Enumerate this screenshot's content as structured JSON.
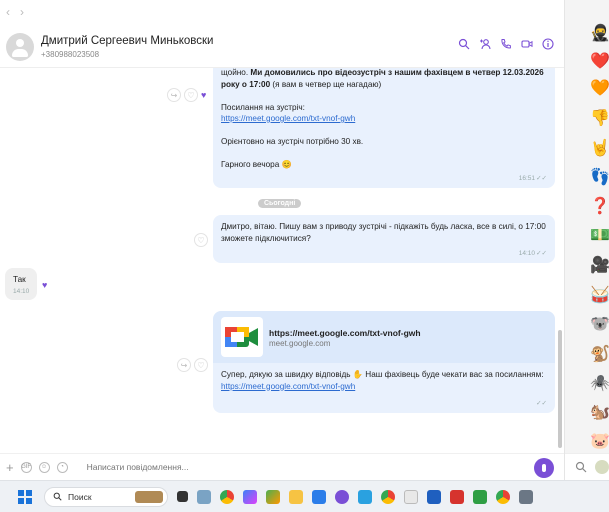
{
  "nav": {
    "back": "‹",
    "forward": "›"
  },
  "contact": {
    "name": "Дмитрий Сергеевич Миньковски",
    "phone": "+380988023508"
  },
  "header_icons": [
    "search-icon",
    "add-contact-icon",
    "video-call-icon",
    "voice-call-icon",
    "info-icon"
  ],
  "messages": {
    "m1": {
      "line1_plain": "щойно. ",
      "line1_bold": "Ми домовились про відеозустріч з нашим фахівцем в четвер 12.03.2026 року о 17:00",
      "line1_after": " (я вам в четвер ще нагадаю)",
      "link_label": "Посилання на зустріч:",
      "link": "https://meet.google.com/txt-vnof-gwh",
      "duration": "Орієнтовно на зустріч потрібно 30 хв.",
      "goodbye": "Гарного вечора",
      "emoji": "😊",
      "time": "16:51"
    },
    "date_separator": "Сьогодні",
    "m2": {
      "text": "Дмитро, вітаю. Пишу вам з приводу зустрічі - підкажіть будь ласка, все в силі, о 17:00 зможете підключитися?",
      "time": "14:10"
    },
    "m3": {
      "text": "Так",
      "time": "14:10"
    },
    "m4": {
      "preview_title": "https://meet.google.com/txt-vnof-gwh",
      "preview_domain": "meet.google.com",
      "text_part1": "Супер",
      "text_part2": ", дякую за швидку відповідь",
      "text_part3": " Наш фахівець буде чекати вас за посиланням:",
      "link": "https://meet.google.com/txt-vnof-gwh"
    }
  },
  "composer": {
    "placeholder": "Написати повідомлення..."
  },
  "stickers": [
    "🥷",
    "❤️",
    "🧡",
    "👎",
    "🤘",
    "👣",
    "❓",
    "💵",
    "🎥",
    "🥁",
    "🐨",
    "🐒",
    "🕷️",
    "🐿️",
    "🐷"
  ],
  "taskbar": {
    "search_label": "Поиск"
  },
  "colors": {
    "accent": "#7a4fd6",
    "bubble_out": "#e9f1fd",
    "bubble_in": "#efefef",
    "link": "#2c6bd0"
  }
}
